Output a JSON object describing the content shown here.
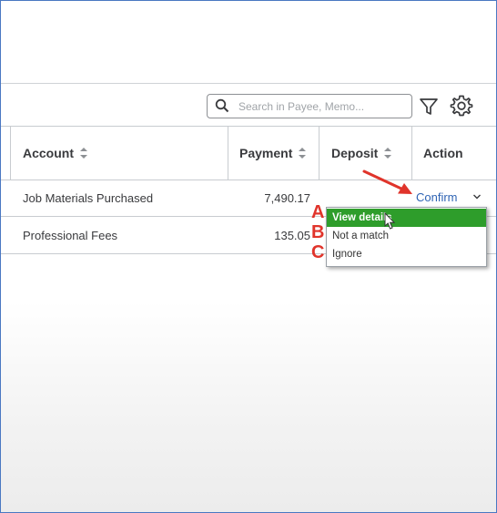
{
  "toolbar": {
    "search_placeholder": "Search in Payee, Memo..."
  },
  "table": {
    "columns": [
      "Account",
      "Payment",
      "Deposit",
      "Action"
    ],
    "rows": [
      {
        "account": "Job Materials Purchased",
        "payment": "7,490.17",
        "deposit": "",
        "action": "Confirm"
      },
      {
        "account": "Professional Fees",
        "payment": "135.05",
        "deposit": "",
        "action": ""
      }
    ]
  },
  "action_menu": {
    "items": [
      "View details",
      "Not a match",
      "Ignore"
    ],
    "selected": "View details"
  },
  "annotations": {
    "letters": [
      "A",
      "B",
      "C"
    ]
  },
  "colors": {
    "accent_green": "#2e9d2b",
    "link_blue": "#2f64b4",
    "annotation_red": "#e0342b"
  }
}
